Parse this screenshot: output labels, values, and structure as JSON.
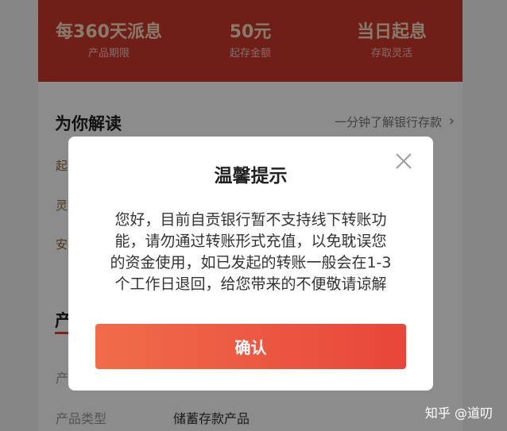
{
  "header": {
    "stats": [
      {
        "value": "每360天派息",
        "label": "产品期限"
      },
      {
        "value": "50元",
        "label": "起存金额"
      },
      {
        "value": "当日起息",
        "label": "存取灵活"
      }
    ]
  },
  "section": {
    "title": "为你解读",
    "link": "一分钟了解银行存款",
    "items": [
      "起",
      "灵",
      "安"
    ]
  },
  "product": {
    "title": "产",
    "rows": [
      {
        "label": "产",
        "value": ""
      },
      {
        "label": "产品类型",
        "value": "储蓄存款产品"
      }
    ]
  },
  "modal": {
    "title": "温馨提示",
    "lines": [
      "您好，目前自贡银行暂不支持线下转账功",
      "能，请勿通过转账形式充值，以免耽误您",
      "的资金使用，如已发起的转账一般会在1-3",
      "个工作日退回，给您带来的不便敬请谅解"
    ],
    "confirm_label": "确认"
  },
  "watermark": "知乎 @道叨"
}
